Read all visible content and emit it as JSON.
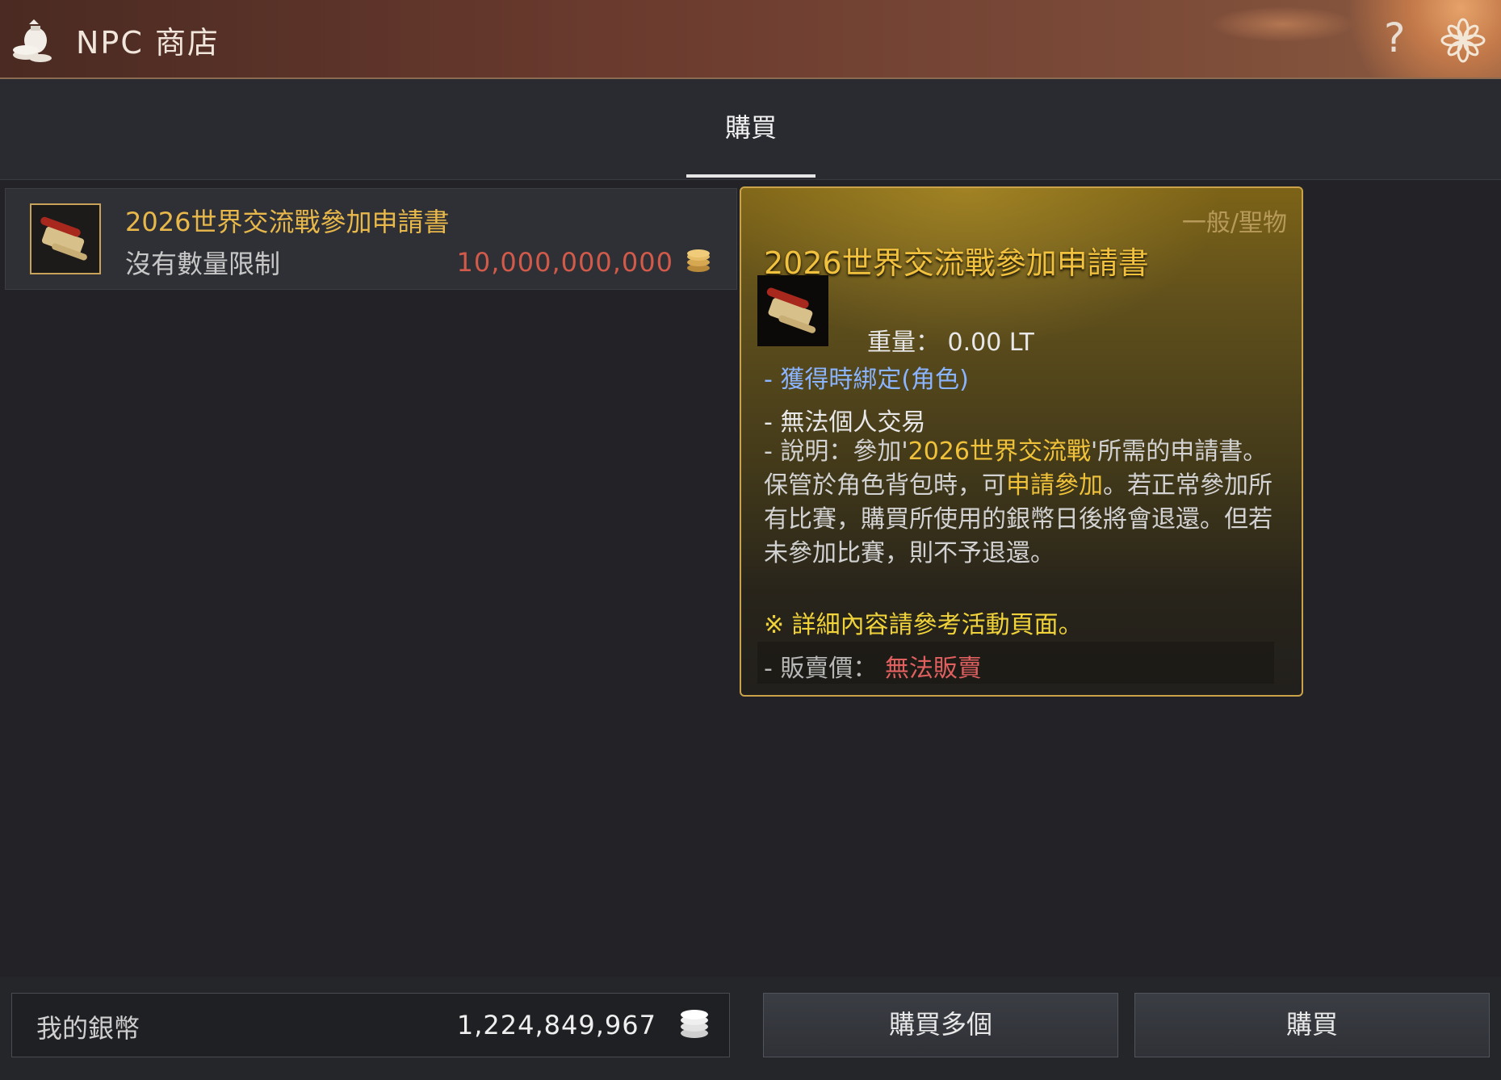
{
  "window": {
    "title": "NPC 商店"
  },
  "tabs": [
    {
      "label": "購買"
    }
  ],
  "items": [
    {
      "name": "2026世界交流戰參加申請書",
      "limit": "沒有數量限制",
      "price": "10,000,000,000"
    }
  ],
  "tooltip": {
    "category": "一般/聖物",
    "name": "2026世界交流戰參加申請書",
    "weight": "重量： 0.00 LT",
    "bind": "- 獲得時綁定(角色)",
    "trade": "- 無法個人交易",
    "desc_prefix": "- 說明：參加'",
    "desc_hl1": "2026世界交流戰",
    "desc_mid1": "'所需的申請書。保管於角色背包時，可",
    "desc_hl2": "申請參加",
    "desc_rest": "。若正常參加所有比賽，購買所使用的銀幣日後將會退還。但若未參加比賽，則不予退還。",
    "note": "※ 詳細內容請參考活動頁面。",
    "sell_label": "- 販賣價：",
    "sell_value": "無法販賣"
  },
  "wallet": {
    "label": "我的銀幣",
    "amount": "1,224,849,967"
  },
  "buttons": {
    "buy_multiple": "購買多個",
    "buy": "購買"
  },
  "colors": {
    "title_bar": "#6a3a2e",
    "item_name": "#e8b84a",
    "price": "#d25a4a",
    "tooltip_border": "#c9a24a",
    "bind_text": "#8ab4ff",
    "unsellable": "#e06060"
  },
  "icons": [
    "money-bag-icon",
    "help-icon",
    "settings-flower-icon",
    "scroll-icon",
    "silver-coin-icon"
  ]
}
